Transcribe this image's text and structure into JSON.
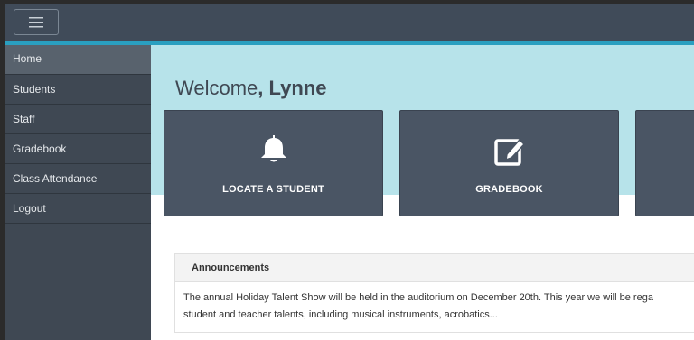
{
  "colors": {
    "topbar": "#404b59",
    "accent": "#2a9fc0",
    "sidebar": "#3f4853",
    "sidebar_active": "#58626d",
    "hero": "#b7e3ea",
    "tile": "#4a5564"
  },
  "header": {
    "menu_icon": "hamburger-icon"
  },
  "sidebar": {
    "items": [
      {
        "label": "Home",
        "active": true
      },
      {
        "label": "Students"
      },
      {
        "label": "Staff"
      },
      {
        "label": "Gradebook"
      },
      {
        "label": "Class Attendance"
      },
      {
        "label": "Logout"
      }
    ]
  },
  "main": {
    "welcome_prefix": "Welcome",
    "welcome_comma": ", ",
    "welcome_name": "Lynne",
    "tiles": [
      {
        "label": "LOCATE A STUDENT",
        "icon": "bell-icon"
      },
      {
        "label": "GRADEBOOK",
        "icon": "edit-icon"
      },
      {
        "label": "",
        "icon": ""
      }
    ],
    "announcements": {
      "title": "Announcements",
      "line1": "The annual Holiday Talent Show will be held in the auditorium on December 20th. This year we will be rega",
      "line2": "student and teacher talents, including musical instruments, acrobatics..."
    }
  }
}
